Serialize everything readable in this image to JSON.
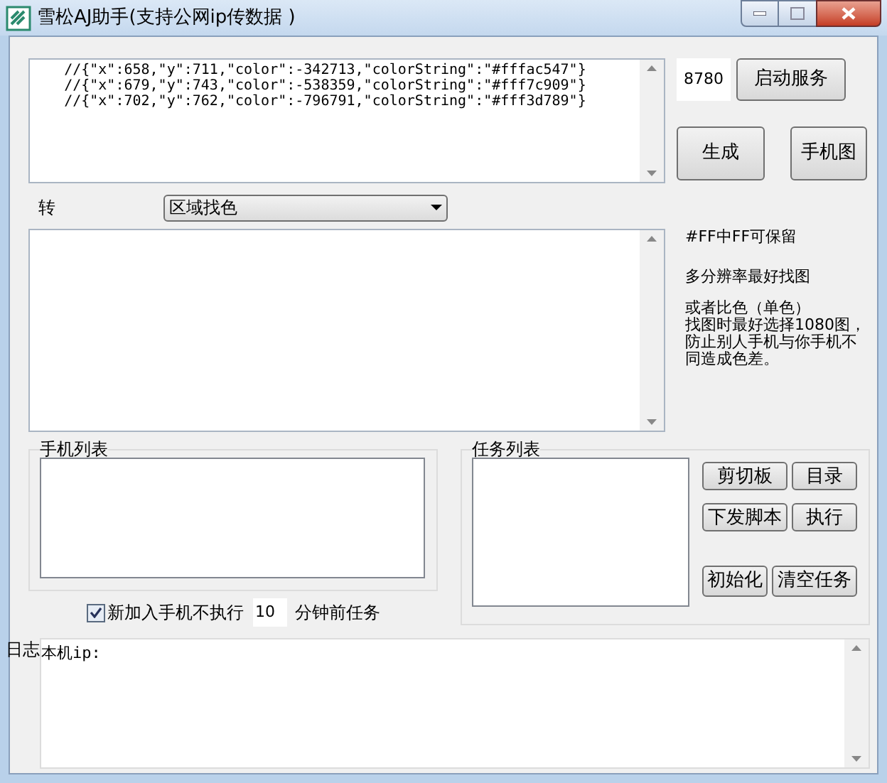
{
  "window": {
    "title": "雪松AJ助手(支持公网ip传数据 )"
  },
  "code_box": {
    "lines": [
      "    //{\"x\":658,\"y\":711,\"color\":-342713,\"colorString\":\"#fffac547\"}",
      "    //{\"x\":679,\"y\":743,\"color\":-538359,\"colorString\":\"#fff7c909\"}",
      "    //{\"x\":702,\"y\":762,\"color\":-796791,\"colorString\":\"#fff3d789\"}"
    ]
  },
  "port": {
    "value": "8780"
  },
  "start_button": "启动服务",
  "generate_button": "生成",
  "phone_image_button": "手机图",
  "convert": {
    "label": "转",
    "dropdown": "区域找色"
  },
  "hints": [
    "#FF中FF可保留",
    "多分辨率最好找图",
    "或者比色（单色）",
    "找图时最好选择1080图，防止别人手机与你手机不同造成色差。"
  ],
  "phone_list": {
    "title": "手机列表"
  },
  "task_list": {
    "title": "任务列表"
  },
  "task_buttons": [
    [
      "剪切板",
      "目录"
    ],
    [
      "下发脚本",
      "执行"
    ]
  ],
  "task_bottom_buttons": [
    "初始化",
    "清空任务"
  ],
  "option": {
    "checked": true,
    "label": "新加入手机不执行",
    "minutes": "10",
    "suffix": "分钟前任务"
  },
  "log": {
    "label": "日志",
    "text": "本机ip:"
  }
}
